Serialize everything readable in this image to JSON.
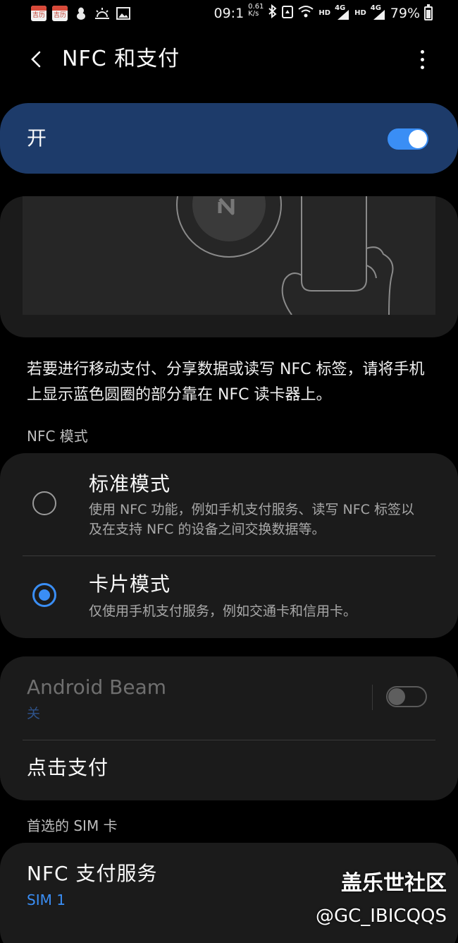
{
  "status_bar": {
    "app_badge_1": "吉历",
    "app_badge_2": "吉历",
    "time": "09:1",
    "net_speed_top": "0.61",
    "net_speed_bottom": "K/s",
    "hd_1": "HD",
    "lte_1": "4G",
    "hd_2": "HD",
    "lte_2": "4G",
    "battery": "79%"
  },
  "header": {
    "title": "NFC 和支付"
  },
  "master_switch": {
    "label": "开",
    "state": "on"
  },
  "description": "若要进行移动支付、分享数据或读写 NFC 标签，请将手机上显示蓝色圆圈的部分靠在 NFC 读卡器上。",
  "nfc_mode": {
    "section_title": "NFC 模式",
    "options": [
      {
        "title": "标准模式",
        "subtitle": "使用 NFC 功能，例如手机支付服务、读写 NFC 标签以及在支持 NFC 的设备之间交换数据等。",
        "selected": false
      },
      {
        "title": "卡片模式",
        "subtitle": "仅使用手机支付服务，例如交通卡和信用卡。",
        "selected": true
      }
    ]
  },
  "android_beam": {
    "title": "Android Beam",
    "status": "关",
    "state": "off"
  },
  "tap_pay": {
    "label": "点击支付"
  },
  "preferred_sim": {
    "section_title": "首选的 SIM 卡",
    "title": "NFC 支付服务",
    "value": "SIM 1"
  },
  "watermark": {
    "title": "盖乐世社区",
    "handle": "@GC_IBICQQS"
  },
  "colors": {
    "accent": "#3a8ef5",
    "master_card": "#1d3b6a",
    "card_bg": "#1b1b1b",
    "page_bg": "#000000"
  }
}
